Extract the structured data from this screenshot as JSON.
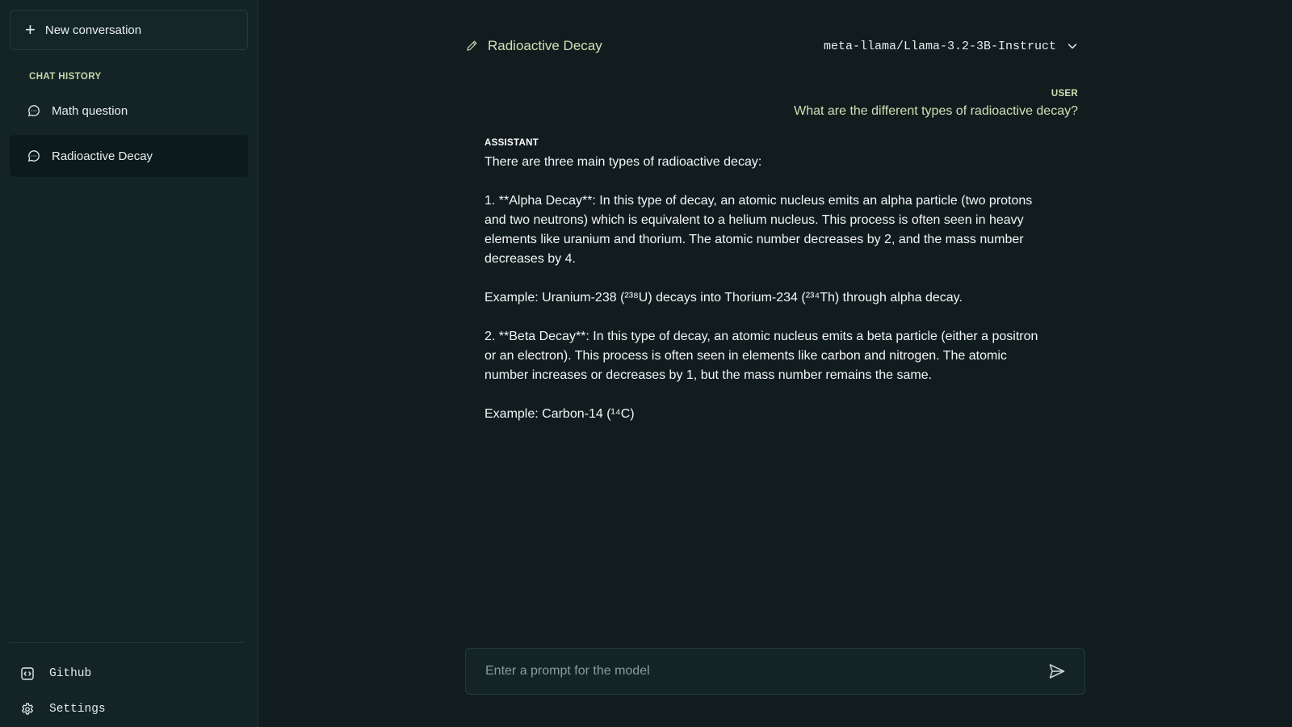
{
  "sidebar": {
    "new_conversation_label": "New conversation",
    "history_heading": "CHAT HISTORY",
    "history": [
      {
        "label": "Math question",
        "icon": "chat-bubble-icon",
        "active": false
      },
      {
        "label": "Radioactive Decay",
        "icon": "chat-bubble-icon",
        "active": true
      }
    ],
    "bottom": [
      {
        "label": "Github",
        "icon": "code-icon"
      },
      {
        "label": "Settings",
        "icon": "gear-icon"
      }
    ]
  },
  "header": {
    "title": "Radioactive Decay",
    "title_icon": "pencil-icon",
    "model": "meta-llama/Llama-3.2-3B-Instruct",
    "model_icon": "chevron-down-icon"
  },
  "messages": {
    "user_role": "USER",
    "user_text": "What are the different types of radioactive decay?",
    "assistant_role": "ASSISTANT",
    "assistant_paragraphs": [
      "There are three main types of radioactive decay:",
      "1. **Alpha Decay**: In this type of decay, an atomic nucleus emits an alpha particle (two protons and two neutrons) which is equivalent to a helium nucleus. This process is often seen in heavy elements like uranium and thorium. The atomic number decreases by 2, and the mass number decreases by 4.",
      "Example: Uranium-238 (²³⁸U) decays into Thorium-234 (²³⁴Th) through alpha decay.",
      "2. **Beta Decay**: In this type of decay, an atomic nucleus emits a beta particle (either a positron or an electron). This process is often seen in elements like carbon and nitrogen. The atomic number increases or decreases by 1, but the mass number remains the same.",
      "Example: Carbon-14 (¹⁴C)"
    ]
  },
  "prompt": {
    "placeholder": "Enter a prompt for the model",
    "send_icon": "send-icon"
  },
  "colors": {
    "background": "#111c1f",
    "sidebar": "#142326",
    "accent": "#cfe0b4"
  }
}
